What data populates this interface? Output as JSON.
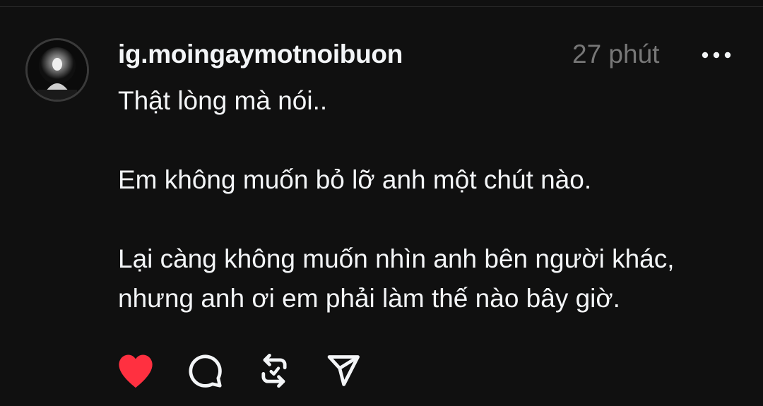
{
  "post": {
    "username": "ig.moingaymotnoibuon",
    "timestamp": "27 phút",
    "paragraphs": [
      "Thật lòng mà nói..",
      "Em không muốn bỏ lỡ anh một chút nào.",
      "Lại càng không muốn nhìn anh bên người khác, nhưng anh ơi em phải làm thế nào bây giờ."
    ]
  },
  "actions": {
    "like_icon": "heart-icon",
    "like_color": "#ff3040",
    "liked": true,
    "comment_icon": "comment-icon",
    "repost_icon": "repost-icon",
    "share_icon": "send-icon"
  },
  "menu_icon": "more-dots-icon",
  "colors": {
    "background": "#101010",
    "text": "#f3f5f7",
    "muted": "#777777"
  }
}
